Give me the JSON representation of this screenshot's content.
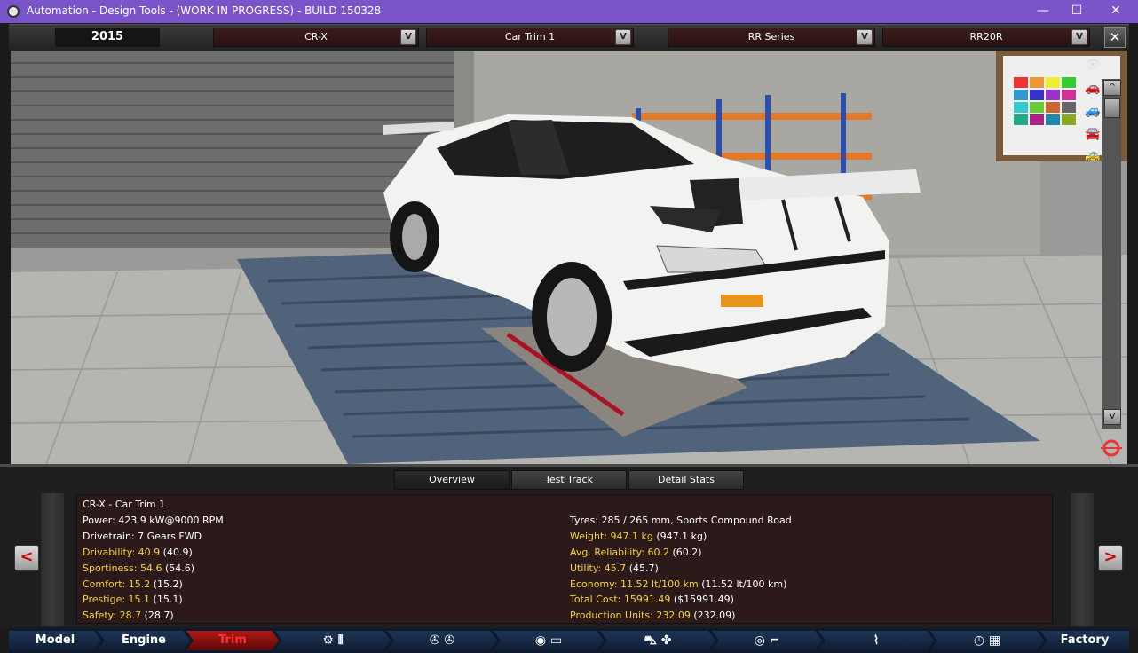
{
  "window": {
    "title": "Automation - Design Tools - (WORK IN PROGRESS) - BUILD 150328",
    "minimize": "—",
    "maximize": "☐",
    "close": "✕"
  },
  "topbar": {
    "year": "2015",
    "model": "CR-X",
    "trim": "Car Trim 1",
    "engine_family": "RR Series",
    "engine_variant": "RR20R",
    "dropdown_arrow": "V",
    "close": "✕"
  },
  "viewport": {
    "scroll_up": "^",
    "scroll_down": "V"
  },
  "tabs": [
    {
      "label": "Overview",
      "active": true
    },
    {
      "label": "Test Track",
      "active": false
    },
    {
      "label": "Detail Stats",
      "active": false
    }
  ],
  "stats": {
    "header": "CR-X - Car Trim 1",
    "left": [
      {
        "label": "Power: 423.9 kW@9000 RPM",
        "highlight": ""
      },
      {
        "label": "Drivetrain: 7 Gears FWD",
        "highlight": ""
      },
      {
        "label": "",
        "highlight": "Drivability: 40.9",
        "extra": " (40.9)"
      },
      {
        "label": "",
        "highlight": "Sportiness: 54.6",
        "extra": " (54.6)"
      },
      {
        "label": "",
        "highlight": "Comfort: 15.2",
        "extra": " (15.2)"
      },
      {
        "label": "",
        "highlight": "Prestige: 15.1",
        "extra": " (15.1)"
      },
      {
        "label": "",
        "highlight": "Safety: 28.7",
        "extra": " (28.7)"
      }
    ],
    "right": [
      {
        "label": "Tyres: 285 / 265 mm, Sports Compound Road",
        "highlight": ""
      },
      {
        "label": "",
        "highlight": "Weight: 947.1 kg",
        "extra": " (947.1 kg)"
      },
      {
        "label": "",
        "highlight": "Avg. Reliability: 60.2",
        "extra": " (60.2)"
      },
      {
        "label": "",
        "highlight": "Utility: 45.7",
        "extra": " (45.7)"
      },
      {
        "label": "",
        "highlight": "Economy: 11.52 lt/100 km",
        "extra": " (11.52 lt/100 km)"
      },
      {
        "label": "",
        "highlight": "Total Cost: 15991.49",
        "extra": " ($15991.49)"
      },
      {
        "label": "",
        "highlight": "Production Units: 232.09",
        "extra": " (232.09)"
      }
    ],
    "prev": "<",
    "next": ">"
  },
  "navbar": {
    "model": "Model",
    "engine": "Engine",
    "trim": "Trim",
    "factory": "Factory",
    "icons": [
      "gearbox-icon",
      "wheels-icon",
      "chassis-icon",
      "body-icon",
      "interior-icon",
      "suspension-icon",
      "testing-icon"
    ]
  },
  "colors": {
    "title_bar": "#7a55c9",
    "highlight_text": "#f5d33c",
    "active_tab": "#b01818",
    "nav_bg": "#0f1e33"
  }
}
